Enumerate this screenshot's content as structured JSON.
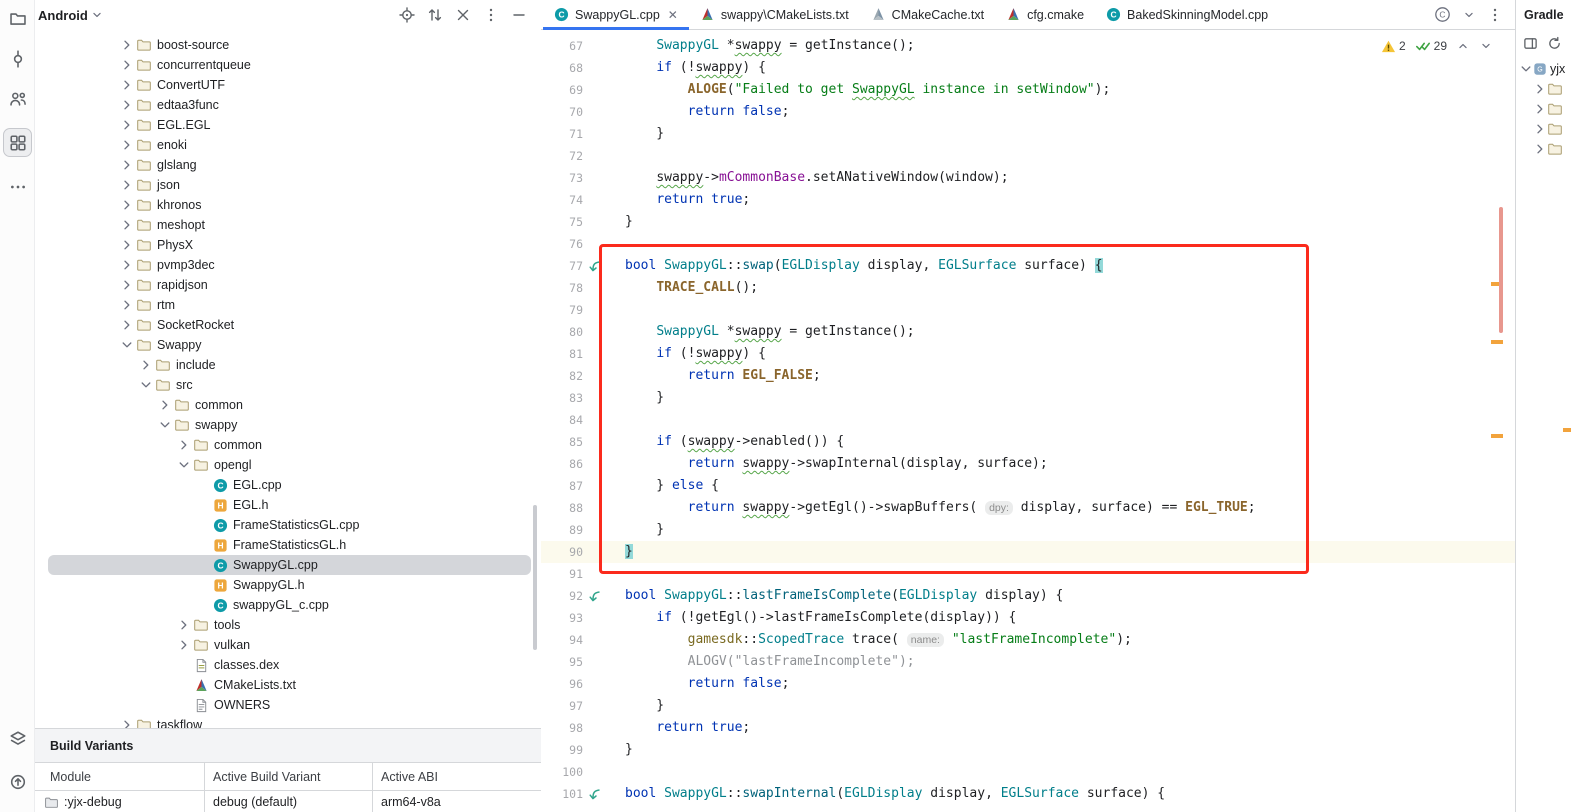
{
  "colors": {
    "accent": "#3574F0",
    "border": "#D5D7DA",
    "kw": "#0033B3",
    "type": "#007E8A",
    "fn": "#00627A",
    "str": "#067D17",
    "macro": "#8A652C",
    "field": "#871094",
    "ns": "#7A6A21",
    "gray": "#8F9296",
    "hint_bg": "#EBECEC",
    "hint_fg": "#8C8C8C",
    "typo": "#57A64A",
    "line_num": "#A7A8AC",
    "caret_line": "#FCFAED",
    "brace_match": "#93D9D9",
    "tree_selection": "#D4D6DA",
    "annotation": "#FB2A1C",
    "warning": "#F5C538",
    "ok": "#3FA342",
    "stripe_mark": "#F2A33C",
    "scroll_thumb": "#E8978E"
  },
  "left_toolbar": {
    "top": [
      "project-folder",
      "commit",
      "pull-requests",
      "resource-manager",
      "more-tools"
    ],
    "selected_index": 3,
    "bottom": [
      "build-variants",
      "device-manager"
    ]
  },
  "project_panel": {
    "title": "Android",
    "actions": [
      "locate-file",
      "sort",
      "close",
      "more-vertical",
      "hide-panel"
    ],
    "tree": [
      {
        "label": "boost-source",
        "level": 0,
        "chevron": "right",
        "icon": "folder"
      },
      {
        "label": "concurrentqueue",
        "level": 0,
        "chevron": "right",
        "icon": "folder"
      },
      {
        "label": "ConvertUTF",
        "level": 0,
        "chevron": "right",
        "icon": "folder"
      },
      {
        "label": "edtaa3func",
        "level": 0,
        "chevron": "right",
        "icon": "folder"
      },
      {
        "label": "EGL.EGL",
        "level": 0,
        "chevron": "right",
        "icon": "folder"
      },
      {
        "label": "enoki",
        "level": 0,
        "chevron": "right",
        "icon": "folder"
      },
      {
        "label": "glslang",
        "level": 0,
        "chevron": "right",
        "icon": "folder"
      },
      {
        "label": "json",
        "level": 0,
        "chevron": "right",
        "icon": "folder"
      },
      {
        "label": "khronos",
        "level": 0,
        "chevron": "right",
        "icon": "folder"
      },
      {
        "label": "meshopt",
        "level": 0,
        "chevron": "right",
        "icon": "folder"
      },
      {
        "label": "PhysX",
        "level": 0,
        "chevron": "right",
        "icon": "folder"
      },
      {
        "label": "pvmp3dec",
        "level": 0,
        "chevron": "right",
        "icon": "folder"
      },
      {
        "label": "rapidjson",
        "level": 0,
        "chevron": "right",
        "icon": "folder"
      },
      {
        "label": "rtm",
        "level": 0,
        "chevron": "right",
        "icon": "folder"
      },
      {
        "label": "SocketRocket",
        "level": 0,
        "chevron": "right",
        "icon": "folder"
      },
      {
        "label": "Swappy",
        "level": 0,
        "chevron": "down",
        "icon": "folder"
      },
      {
        "label": "include",
        "level": 1,
        "chevron": "right",
        "icon": "folder"
      },
      {
        "label": "src",
        "level": 1,
        "chevron": "down",
        "icon": "folder"
      },
      {
        "label": "common",
        "level": 2,
        "chevron": "right",
        "icon": "folder"
      },
      {
        "label": "swappy",
        "level": 2,
        "chevron": "down",
        "icon": "folder"
      },
      {
        "label": "common",
        "level": 3,
        "chevron": "right",
        "icon": "folder"
      },
      {
        "label": "opengl",
        "level": 3,
        "chevron": "down",
        "icon": "folder"
      },
      {
        "label": "EGL.cpp",
        "level": 4,
        "icon": "cpp"
      },
      {
        "label": "EGL.h",
        "level": 4,
        "icon": "h"
      },
      {
        "label": "FrameStatisticsGL.cpp",
        "level": 4,
        "icon": "cpp"
      },
      {
        "label": "FrameStatisticsGL.h",
        "level": 4,
        "icon": "h"
      },
      {
        "label": "SwappyGL.cpp",
        "level": 4,
        "icon": "cpp",
        "selected": true
      },
      {
        "label": "SwappyGL.h",
        "level": 4,
        "icon": "h"
      },
      {
        "label": "swappyGL_c.cpp",
        "level": 4,
        "icon": "cpp"
      },
      {
        "label": "tools",
        "level": 3,
        "chevron": "right",
        "icon": "folder"
      },
      {
        "label": "vulkan",
        "level": 3,
        "chevron": "right",
        "icon": "folder"
      },
      {
        "label": "classes.dex",
        "level": 3,
        "icon": "dex"
      },
      {
        "label": "CMakeLists.txt",
        "level": 3,
        "icon": "cmake"
      },
      {
        "label": "OWNERS",
        "level": 3,
        "icon": "text"
      },
      {
        "label": "taskflow",
        "level": 0,
        "chevron": "right",
        "icon": "folder"
      }
    ]
  },
  "build_variants": {
    "title": "Build Variants",
    "columns": [
      "Module",
      "Active Build Variant",
      "Active ABI"
    ],
    "rows": [
      [
        ":yjx-debug",
        "debug (default)",
        "arm64-v8a"
      ]
    ]
  },
  "editor": {
    "tabs": [
      {
        "label": "SwappyGL.cpp",
        "icon": "cpp",
        "active": true,
        "closable": true
      },
      {
        "label": "swappy\\CMakeLists.txt",
        "icon": "cmake"
      },
      {
        "label": "CMakeCache.txt",
        "icon": "cmake-gray"
      },
      {
        "label": "cfg.cmake",
        "icon": "cmake"
      },
      {
        "label": "BakedSkinningModel.cpp",
        "icon": "cpp"
      }
    ],
    "inspection": {
      "warnings": "2",
      "ok": "29"
    },
    "lines": [
      {
        "n": 67,
        "t": [
          [
            "    "
          ],
          [
            "SwappyGL",
            "type"
          ],
          [
            " *"
          ],
          [
            "swappy",
            "",
            "u"
          ],
          [
            " = "
          ],
          [
            "getInstance"
          ],
          [
            "();"
          ]
        ]
      },
      {
        "n": 68,
        "t": [
          [
            "    "
          ],
          [
            "if",
            "kw"
          ],
          [
            " (!"
          ],
          [
            "swappy",
            "",
            "u"
          ],
          [
            ") {"
          ]
        ]
      },
      {
        "n": 69,
        "t": [
          [
            "        "
          ],
          [
            "ALOGE",
            "macro"
          ],
          [
            "("
          ],
          [
            "\"Failed to get ",
            "str"
          ],
          [
            "SwappyGL",
            "str",
            "u"
          ],
          [
            " instance in setWindow\"",
            "str"
          ],
          [
            ");"
          ]
        ]
      },
      {
        "n": 70,
        "t": [
          [
            "        "
          ],
          [
            "return",
            "kw"
          ],
          [
            " "
          ],
          [
            "false",
            "kw"
          ],
          [
            ";"
          ]
        ]
      },
      {
        "n": 71,
        "t": [
          [
            "    }"
          ]
        ]
      },
      {
        "n": 72,
        "t": []
      },
      {
        "n": 73,
        "t": [
          [
            "    "
          ],
          [
            "swappy",
            "",
            "u"
          ],
          [
            "->"
          ],
          [
            "mCommonBase",
            "field"
          ],
          [
            "."
          ],
          [
            "setANativeWindow"
          ],
          [
            "(window);"
          ]
        ]
      },
      {
        "n": 74,
        "t": [
          [
            "    "
          ],
          [
            "return",
            "kw"
          ],
          [
            " "
          ],
          [
            "true",
            "kw"
          ],
          [
            ";"
          ]
        ]
      },
      {
        "n": 75,
        "t": [
          [
            "}"
          ]
        ]
      },
      {
        "n": 76,
        "t": []
      },
      {
        "n": 77,
        "g": true,
        "t": [
          [
            "bool",
            "kw"
          ],
          [
            " "
          ],
          [
            "SwappyGL",
            "type"
          ],
          [
            "::"
          ],
          [
            "swap",
            "fn"
          ],
          [
            "("
          ],
          [
            "EGLDisplay",
            "type"
          ],
          [
            " display, "
          ],
          [
            "EGLSurface",
            "type"
          ],
          [
            " surface) "
          ],
          [
            "{",
            "brace"
          ]
        ]
      },
      {
        "n": 78,
        "t": [
          [
            "    "
          ],
          [
            "TRACE_CALL",
            "macro"
          ],
          [
            "();"
          ]
        ]
      },
      {
        "n": 79,
        "t": []
      },
      {
        "n": 80,
        "t": [
          [
            "    "
          ],
          [
            "SwappyGL",
            "type"
          ],
          [
            " *"
          ],
          [
            "swappy",
            "",
            "u"
          ],
          [
            " = "
          ],
          [
            "getInstance"
          ],
          [
            "();"
          ]
        ]
      },
      {
        "n": 81,
        "t": [
          [
            "    "
          ],
          [
            "if",
            "kw"
          ],
          [
            " (!"
          ],
          [
            "swappy",
            "",
            "u"
          ],
          [
            ") {"
          ]
        ]
      },
      {
        "n": 82,
        "t": [
          [
            "        "
          ],
          [
            "return",
            "kw"
          ],
          [
            " "
          ],
          [
            "EGL_FALSE",
            "macro"
          ],
          [
            ";"
          ]
        ]
      },
      {
        "n": 83,
        "t": [
          [
            "    }"
          ]
        ]
      },
      {
        "n": 84,
        "t": []
      },
      {
        "n": 85,
        "t": [
          [
            "    "
          ],
          [
            "if",
            "kw"
          ],
          [
            " ("
          ],
          [
            "swappy",
            "",
            "u"
          ],
          [
            "->"
          ],
          [
            "enabled"
          ],
          [
            "()) {"
          ]
        ]
      },
      {
        "n": 86,
        "t": [
          [
            "        "
          ],
          [
            "return",
            "kw"
          ],
          [
            " "
          ],
          [
            "swappy",
            "",
            "u"
          ],
          [
            "->"
          ],
          [
            "swapInternal"
          ],
          [
            "(display, surface);"
          ]
        ]
      },
      {
        "n": 87,
        "t": [
          [
            "    } "
          ],
          [
            "else",
            "kw"
          ],
          [
            " {"
          ]
        ]
      },
      {
        "n": 88,
        "t": [
          [
            "        "
          ],
          [
            "return",
            "kw"
          ],
          [
            " "
          ],
          [
            "swappy",
            "",
            "u"
          ],
          [
            "->"
          ],
          [
            "getEgl"
          ],
          [
            "()->"
          ],
          [
            "swapBuffers"
          ],
          [
            "( "
          ],
          [
            "dpy:",
            "hint"
          ],
          [
            " display, surface) == "
          ],
          [
            "EGL_TRUE",
            "macro"
          ],
          [
            ";"
          ]
        ]
      },
      {
        "n": 89,
        "t": [
          [
            "    }"
          ]
        ]
      },
      {
        "n": 90,
        "hl": true,
        "t": [
          [
            "}",
            "brace"
          ]
        ]
      },
      {
        "n": 91,
        "t": []
      },
      {
        "n": 92,
        "g": true,
        "t": [
          [
            "bool",
            "kw"
          ],
          [
            " "
          ],
          [
            "SwappyGL",
            "type"
          ],
          [
            "::"
          ],
          [
            "lastFrameIsComplete",
            "fn"
          ],
          [
            "("
          ],
          [
            "EGLDisplay",
            "type"
          ],
          [
            " display) {"
          ]
        ]
      },
      {
        "n": 93,
        "t": [
          [
            "    "
          ],
          [
            "if",
            "kw"
          ],
          [
            " (!"
          ],
          [
            "getEgl"
          ],
          [
            "()->"
          ],
          [
            "lastFrameIsComplete"
          ],
          [
            "(display)) {"
          ]
        ]
      },
      {
        "n": 94,
        "t": [
          [
            "        "
          ],
          [
            "gamesdk",
            "ns"
          ],
          [
            "::"
          ],
          [
            "ScopedTrace",
            "type"
          ],
          [
            " trace( "
          ],
          [
            "name:",
            "hint"
          ],
          [
            " "
          ],
          [
            "\"lastFrameIncomplete\"",
            "str"
          ],
          [
            ");"
          ]
        ]
      },
      {
        "n": 95,
        "t": [
          [
            "        "
          ],
          [
            "ALOGV(\"lastFrameIncomplete\");",
            "gray"
          ]
        ]
      },
      {
        "n": 96,
        "t": [
          [
            "        "
          ],
          [
            "return",
            "kw"
          ],
          [
            " "
          ],
          [
            "false",
            "kw"
          ],
          [
            ";"
          ]
        ]
      },
      {
        "n": 97,
        "t": [
          [
            "    }"
          ]
        ]
      },
      {
        "n": 98,
        "t": [
          [
            "    "
          ],
          [
            "return",
            "kw"
          ],
          [
            " "
          ],
          [
            "true",
            "kw"
          ],
          [
            ";"
          ]
        ]
      },
      {
        "n": 99,
        "t": [
          [
            "}"
          ]
        ]
      },
      {
        "n": 100,
        "t": []
      },
      {
        "n": 101,
        "g": true,
        "t": [
          [
            "bool",
            "kw"
          ],
          [
            " "
          ],
          [
            "SwappyGL",
            "type"
          ],
          [
            "::"
          ],
          [
            "swapInternal",
            "fn"
          ],
          [
            "("
          ],
          [
            "EGLDisplay",
            "type"
          ],
          [
            " display, "
          ],
          [
            "EGLSurface",
            "type"
          ],
          [
            " surface) {"
          ]
        ]
      }
    ]
  },
  "gradle_panel": {
    "title": "Gradle",
    "toolbar": [
      "layout",
      "refresh"
    ],
    "rows": [
      {
        "label": "yjx",
        "chevron": "down",
        "icon": "gradle-project",
        "level": 0
      },
      {
        "label": "",
        "chevron": "right",
        "icon": "folder",
        "level": 1
      },
      {
        "label": "",
        "chevron": "right",
        "icon": "folder",
        "level": 1
      },
      {
        "label": "",
        "chevron": "right",
        "icon": "folder",
        "level": 1
      },
      {
        "label": "",
        "chevron": "right",
        "icon": "folder",
        "level": 1
      }
    ]
  }
}
